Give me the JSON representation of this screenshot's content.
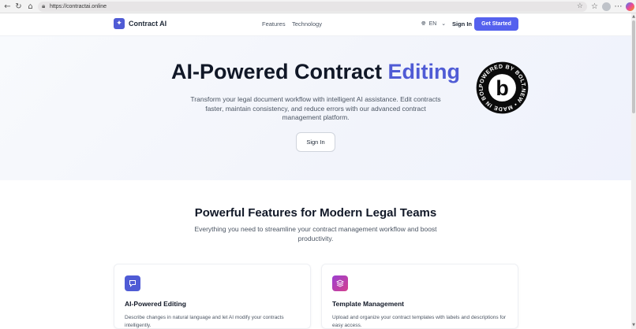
{
  "browser": {
    "url": "https://contractai.online",
    "icons": [
      "back-arrow-icon",
      "reload-icon",
      "home-icon",
      "lock-icon",
      "star-icon",
      "favorites-icon",
      "profile-icon",
      "more-icon",
      "copilot-icon"
    ]
  },
  "header": {
    "logo_text": "Contract AI",
    "nav": {
      "features": "Features",
      "technology": "Technology"
    },
    "language": "EN",
    "sign_in": "Sign In",
    "get_started": "Get Started"
  },
  "hero": {
    "title_main": "AI-Powered Contract ",
    "title_accent": "Editing",
    "subtitle": "Transform your legal document workflow with intelligent AI assistance. Edit contracts faster, maintain consistency, and reduce errors with our advanced contract management platform.",
    "button": "Sign In",
    "badge_text": "POWERED BY BOLT.NEW • MADE IN BOLT.NEW •",
    "badge_letter": "b"
  },
  "features": {
    "title": "Powerful Features for Modern Legal Teams",
    "subtitle": "Everything you need to streamline your contract management workflow and boost productivity.",
    "cards": [
      {
        "title": "AI-Powered Editing",
        "description": "Describe changes in natural language and let AI modify your contracts intelligently.",
        "icon": "chat-icon",
        "color": "#4f5bd5"
      },
      {
        "title": "Template Management",
        "description": "Upload and organize your contract templates with labels and descriptions for easy access.",
        "icon": "layers-icon",
        "color": "#b63fb8"
      }
    ]
  },
  "colors": {
    "accent": "#4f5bd5",
    "button": "#5561ee",
    "template_icon": "#b63fb8"
  }
}
